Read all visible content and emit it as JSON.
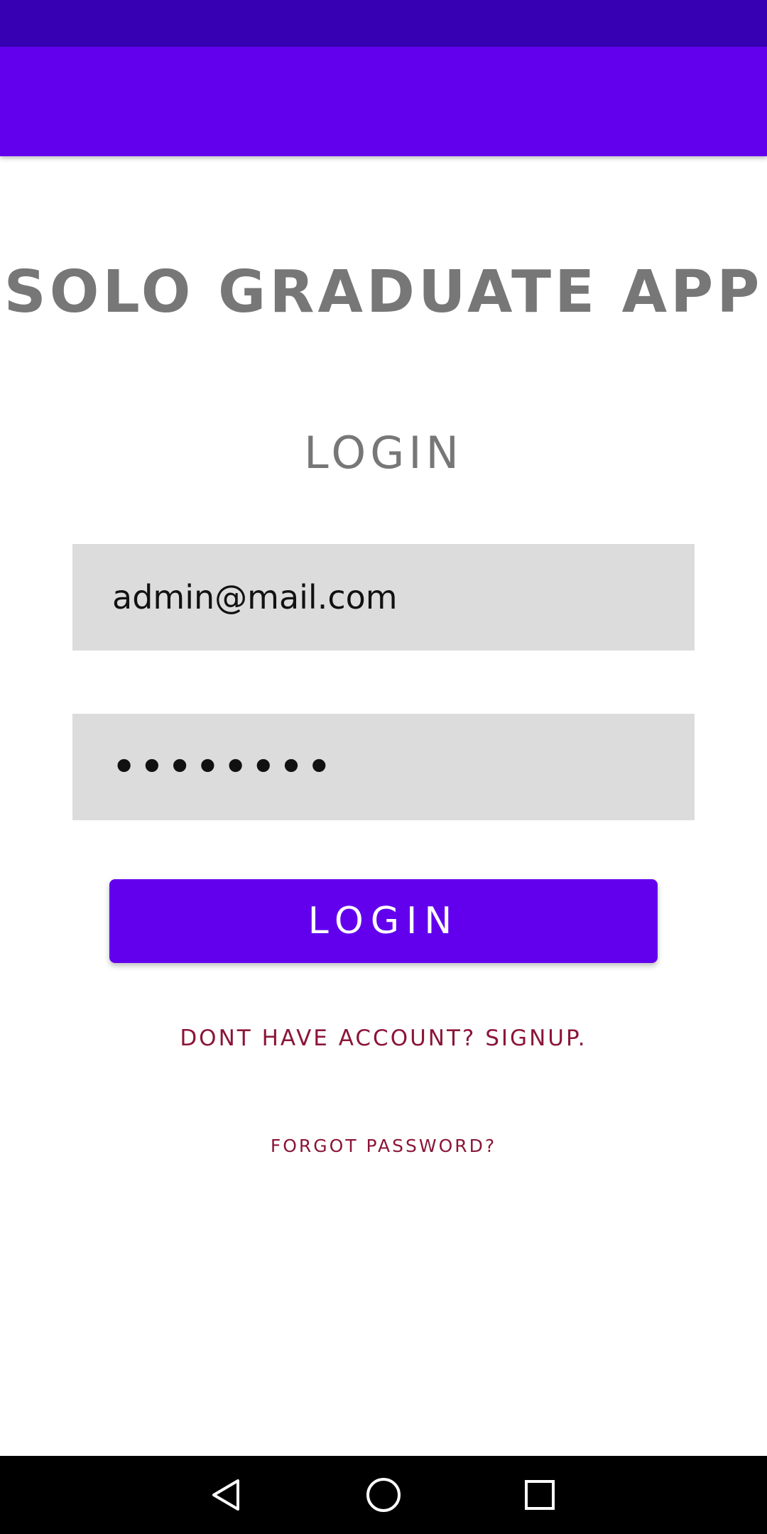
{
  "app": {
    "title": "SOLO GRADUATE APP",
    "heading": "LOGIN"
  },
  "form": {
    "email_value": "admin@mail.com",
    "password_value": "••••••••",
    "login_label": "LOGIN",
    "signup_text": "DONT HAVE ACCOUNT? SIGNUP.",
    "forgot_text": "FORGOT PASSWORD?"
  },
  "nav": {
    "icons": [
      "back-icon",
      "home-icon",
      "recents-icon"
    ]
  },
  "colors": {
    "status_bar": "#3700b3",
    "app_bar": "#6200ee",
    "accent": "#6200ee",
    "link": "#8b1538",
    "field_bg": "#dcdcdc"
  }
}
